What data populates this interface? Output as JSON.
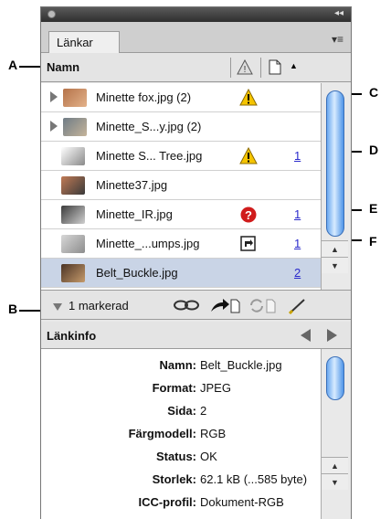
{
  "callouts": {
    "a": "A",
    "b": "B",
    "c": "C",
    "d": "D",
    "e": "E",
    "f": "F"
  },
  "panel": {
    "tab_label": "Länkar",
    "column_header": "Namn",
    "links": [
      {
        "name": "Minette fox.jpg (2)",
        "expandable": true,
        "status": "warning-icon",
        "page": ""
      },
      {
        "name": "Minette_S...y.jpg (2)",
        "expandable": true,
        "status": "",
        "page": ""
      },
      {
        "name": "Minette S... Tree.jpg",
        "expandable": false,
        "status": "warning-icon",
        "page": "1"
      },
      {
        "name": "Minette37.jpg",
        "expandable": false,
        "status": "",
        "page": ""
      },
      {
        "name": "Minette_IR.jpg",
        "expandable": false,
        "status": "missing-icon",
        "page": "1"
      },
      {
        "name": "Minette_...umps.jpg",
        "expandable": false,
        "status": "embedded-icon",
        "page": "1"
      },
      {
        "name": "Belt_Buckle.jpg",
        "expandable": false,
        "status": "",
        "page": "2",
        "selected": true
      }
    ],
    "selected_count": "1 markerad",
    "info_header": "Länkinfo",
    "info": [
      {
        "key": "Namn:",
        "value": "Belt_Buckle.jpg"
      },
      {
        "key": "Format:",
        "value": "JPEG"
      },
      {
        "key": "Sida:",
        "value": "2"
      },
      {
        "key": "Färgmodell:",
        "value": "RGB"
      },
      {
        "key": "Status:",
        "value": "OK"
      },
      {
        "key": "Storlek:",
        "value": "62.1 kB (...585 byte)"
      },
      {
        "key": "ICC-profil:",
        "value": "Dokument-RGB"
      }
    ]
  },
  "colors": {
    "selected_row": "#c9d4e6",
    "link_page": "#2a2acc",
    "warning": "#f5c400",
    "missing": "#d01c1c",
    "scroll_thumb": "#5a9ee8"
  }
}
